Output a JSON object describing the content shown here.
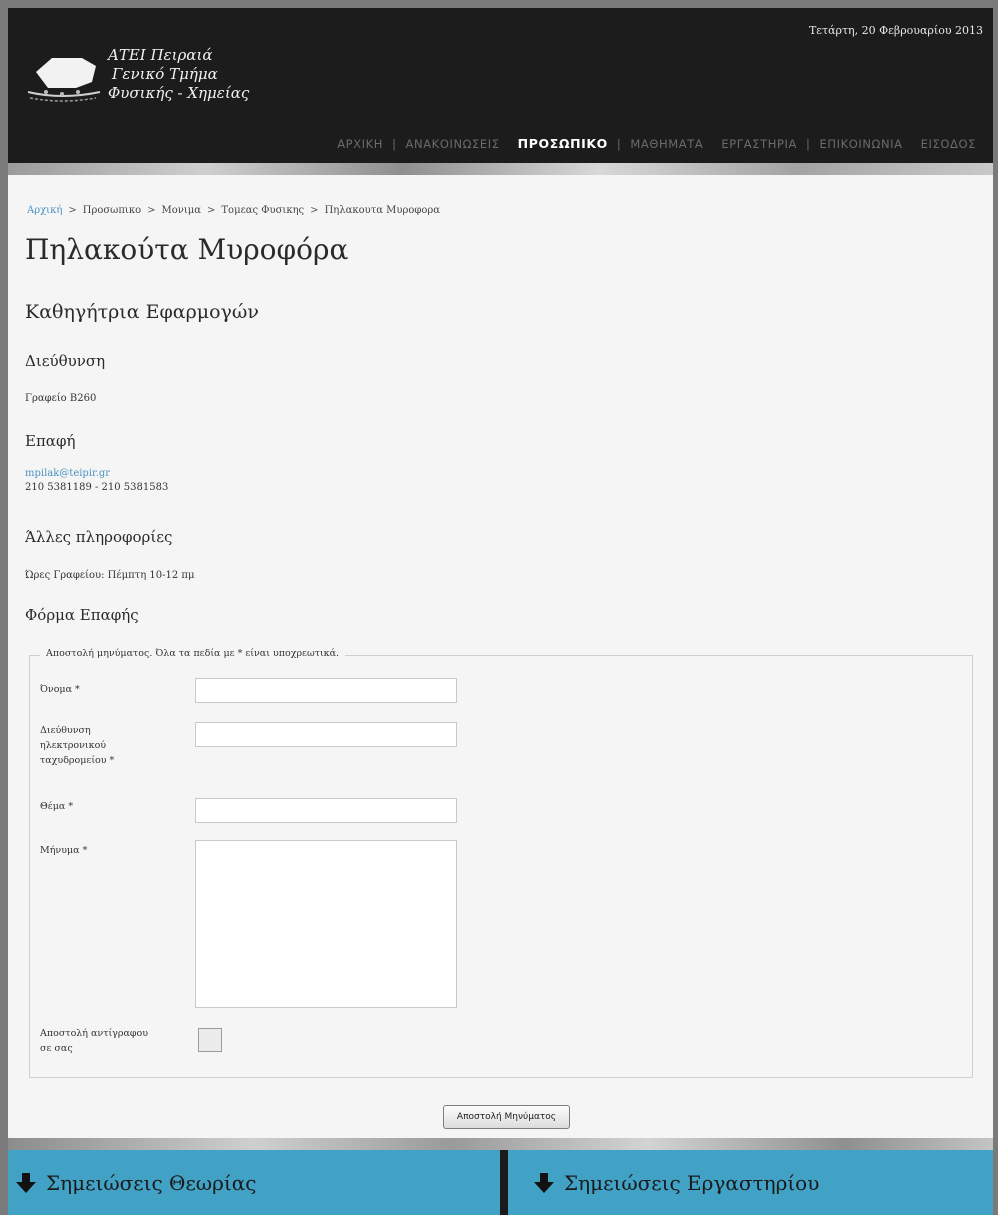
{
  "header": {
    "date": "Τετάρτη, 20 Φεβρουαρίου 2013",
    "logo_lines": [
      "ΑΤΕΙ Πειραιά",
      "Γενικό Τμήμα",
      "Φυσικής - Χημείας"
    ],
    "nav": [
      {
        "label": "ΑΡΧΙΚΗ",
        "active": false
      },
      {
        "label": "ΑΝΑΚΟΙΝΩΣΕΙΣ",
        "active": false
      },
      {
        "label": "ΠΡΟΣΩΠΙΚΟ",
        "active": true
      },
      {
        "label": "ΜΑΘΗΜΑΤΑ",
        "active": false
      },
      {
        "label": "ΕΡΓΑΣΤΗΡΙΑ",
        "active": false
      },
      {
        "label": "ΕΠΙΚΟΙΝΩΝΙΑ",
        "active": false
      },
      {
        "label": "ΕΙΣΟΔΟΣ",
        "active": false
      }
    ]
  },
  "breadcrumb": [
    "Αρχική",
    "Προσωπικο",
    "Μονιμα",
    "Τομεας Φυσικης",
    "Πηλακουτα Μυροφορα"
  ],
  "person": {
    "name": "Πηλακούτα Μυροφόρα",
    "title": "Καθηγήτρια Εφαρμογών"
  },
  "sections": {
    "address_heading": "Διεύθυνση",
    "address_text": "Γραφείο Β260",
    "contact_heading": "Επαφή",
    "email": "mpilak@teipir.gr",
    "phones": "210 5381189 - 210 5381583",
    "other_heading": "Άλλες πληροφορίες",
    "other_text": "Ώρες Γραφείου: Πέμπτη 10-12 πμ",
    "form_heading": "Φόρμα Επαφής"
  },
  "form": {
    "legend": "Αποστολή μηνύματος. Όλα τα πεδία με * είναι υποχρεωτικά.",
    "name_label": "Όνομα *",
    "email_label_1": "Διεύθυνση",
    "email_label_2": "ηλεκτρονικού",
    "email_label_3": "ταχυδρομείου *",
    "subject_label": "Θέμα *",
    "message_label": "Μήνυμα *",
    "copy_label_1": "Αποστολή αντίγραφου",
    "copy_label_2": "σε σας",
    "submit_label": "Αποστολή Μηνύματος",
    "name_value": "",
    "email_value": "",
    "subject_value": "",
    "message_value": "",
    "copy_checked": false
  },
  "footer_links": {
    "left": "Σημειώσεις Θεωρίας",
    "right": "Σημειώσεις Εργαστηρίου"
  },
  "colors": {
    "header_bg": "#1c1c1c",
    "accent_blue": "#42a2c6",
    "link_blue": "#4a92c2"
  },
  "icons": {
    "notes_icon": "arrow-down-icon"
  }
}
